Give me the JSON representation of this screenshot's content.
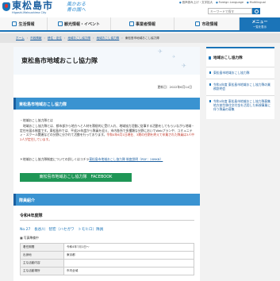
{
  "header": {
    "logo_text": "東松島市",
    "logo_sub": "Higashi-Matsushima City",
    "catchphrase": "風かおる 青の国へ",
    "utilities": [
      "音声読み上げ・文字拡大",
      "Foreign Language",
      "Multilingual"
    ],
    "search_placeholder": "キーワードで探す"
  },
  "nav": {
    "items": [
      "生活情報",
      "観光情報・イベント",
      "事業者情報",
      "市政情報"
    ],
    "menu_label": "メニュー",
    "menu_sub": "一覧を表示"
  },
  "breadcrumb": [
    "ホーム",
    "市政情報",
    "移住・定住",
    "地域おこし協力隊",
    "地域おこし協力隊",
    "東松島市地域おこし協力隊"
  ],
  "main": {
    "title": "東松島市地域おこし協力隊",
    "updated": "更新日：2022年6月14日",
    "section1_heading": "東松島市地域おこし協力隊",
    "intro_label": "・地域おこし協力隊とは",
    "intro_text_before": "地域おこし協力隊とは、都市部から地方へと人材を積極的に受け入れ、地域協力活動に従事する活動をしてもらいながら地域・定住を図る制度です。東松島市では、平成29年度から隊員を迎え、市内各所で多種類な分野においてWebプランや、コミュニティ・スクール関連などの分野に分かれて活動を行っております。",
    "intro_highlight": "令和4年6月1日現在、3期の任期を終えて卒業された隊員は3人中2人が定住しています。",
    "note_label": "＊地域おこし協力隊制度についての詳しくはコチラ",
    "note_link": "東松島市地域おこし協力隊 制度説明（PDF：289KB）",
    "facebook_button": "東松島市地域おこし協力隊　FACEBOOK",
    "section2_heading": "隊員紹介",
    "year_heading": "令和4年度隊",
    "member_line": "No.27　長谷川　智宏（ハセガワ　トモヒロ）隊員",
    "photo_label": "写真準備中",
    "table": [
      {
        "k": "着任期間",
        "v": "令和4年7月1日～"
      },
      {
        "k": "出身地",
        "v": "東京都"
      },
      {
        "k": "主な活動内容",
        "v": ""
      },
      {
        "k": "主な活動場所",
        "v": "市内全域"
      }
    ]
  },
  "sidebar": {
    "title": "地域おこし協力隊",
    "items": [
      "東松島市地域おこし協力隊",
      "令和4年度 東松島市地域おこし協力隊の業務説明会",
      "令和4年度 東松島市地域おこし協力隊募集 地方創生移住交付金を活用した新規事業に伴う隊員の募集"
    ]
  },
  "colors": {
    "brand": "#1b74b8",
    "section": "#3a93d1",
    "facebook": "#1f9656",
    "highlight": "#c0392b"
  }
}
